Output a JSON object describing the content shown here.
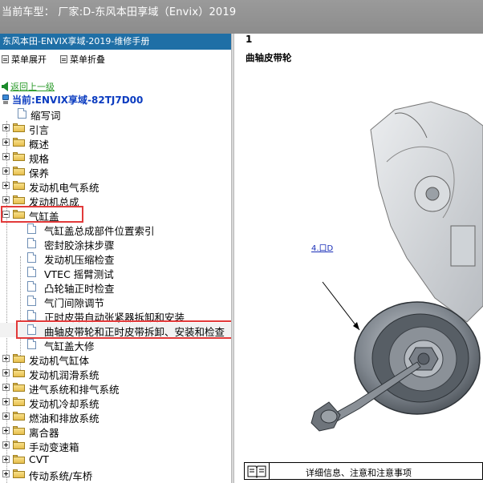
{
  "topbar": {
    "title": "当前车型：  厂家:D-东风本田享域（Envix）2019"
  },
  "manual": {
    "header": "东风本田-ENVIX享域-2019-维修手册"
  },
  "menu": {
    "expand": "菜单展开",
    "collapse": "菜单折叠"
  },
  "nav": {
    "back": "返回上一级",
    "current": "当前:ENVIX享域-82TJ7D00"
  },
  "tree": {
    "items": [
      {
        "label": "缩写词"
      },
      {
        "label": "引言"
      },
      {
        "label": "概述"
      },
      {
        "label": "规格"
      },
      {
        "label": "保养"
      },
      {
        "label": "发动机电气系统"
      },
      {
        "label": "发动机总成"
      },
      {
        "label": "气缸盖"
      },
      {
        "label": "气缸盖总成部件位置索引"
      },
      {
        "label": "密封胶涂抹步骤"
      },
      {
        "label": "发动机压缩检查"
      },
      {
        "label": "VTEC 摇臂测试"
      },
      {
        "label": "凸轮轴正时检查"
      },
      {
        "label": "气门间隙调节"
      },
      {
        "label": "正时皮带自动张紧器拆卸和安装"
      },
      {
        "label": "曲轴皮带轮和正时皮带拆卸、安装和检查"
      },
      {
        "label": "气缸盖大修"
      },
      {
        "label": "发动机气缸体"
      },
      {
        "label": "发动机润滑系统"
      },
      {
        "label": "进气系统和排气系统"
      },
      {
        "label": "发动机冷却系统"
      },
      {
        "label": "燃油和排放系统"
      },
      {
        "label": "离合器"
      },
      {
        "label": "手动变速箱"
      },
      {
        "label": "CVT"
      },
      {
        "label": "传动系统/车桥"
      }
    ]
  },
  "content": {
    "step": "1",
    "caption": "曲轴皮带轮",
    "callout": "4.口D",
    "footer": "详细信息、注意和注意事项"
  },
  "colors": {
    "header": "#1f6fa6",
    "highlight": "#e23a3a",
    "current": "#0b3cc0",
    "back": "#2a9a2a"
  },
  "icons": [
    "folder-icon",
    "document-icon",
    "book-icon",
    "back-arrow-icon",
    "computer-icon"
  ]
}
